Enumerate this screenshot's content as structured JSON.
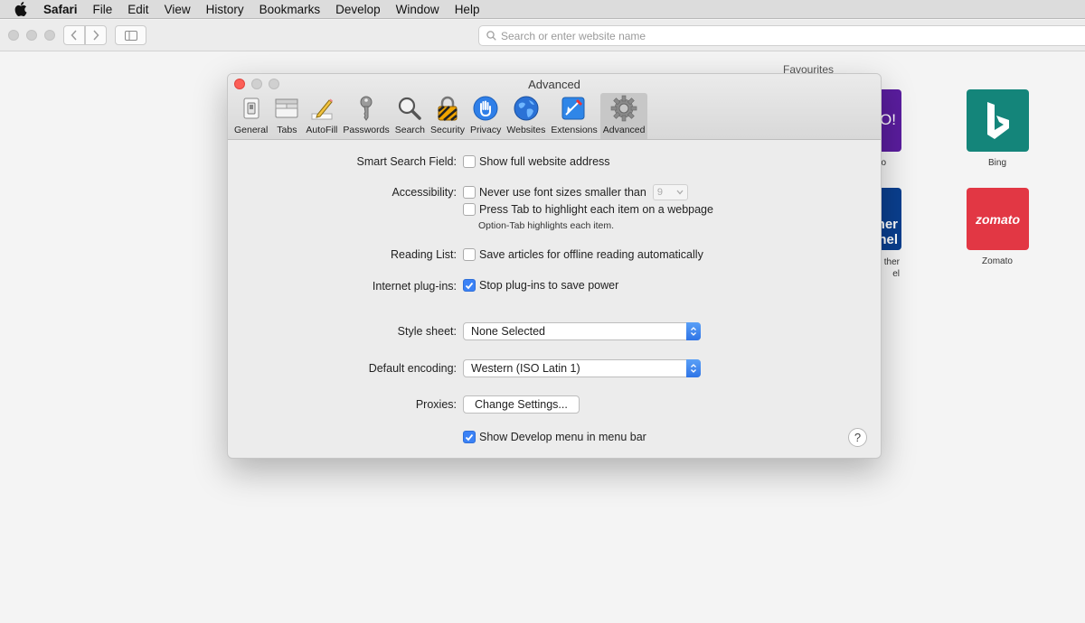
{
  "menubar": {
    "items": [
      "Safari",
      "File",
      "Edit",
      "View",
      "History",
      "Bookmarks",
      "Develop",
      "Window",
      "Help"
    ]
  },
  "toolbar": {
    "search_placeholder": "Search or enter website name"
  },
  "favourites": {
    "title": "Favourites",
    "tiles": [
      {
        "label": "Bing",
        "icon": "bing-logo",
        "color": "#14857a"
      },
      {
        "label": "Zomato",
        "icon": "zomato-logo",
        "text": "zomato",
        "color": "#e23744"
      }
    ],
    "partial_tiles": [
      {
        "text": "O!",
        "color": "#5a1d9e"
      },
      {
        "text": "her\nnel",
        "color": "#0a3f8f"
      }
    ],
    "partial_labels": [
      "o",
      "ther",
      "el"
    ]
  },
  "window": {
    "title": "Advanced",
    "tabs": [
      {
        "label": "General",
        "icon": "general-switch-icon"
      },
      {
        "label": "Tabs",
        "icon": "tabs-icon"
      },
      {
        "label": "AutoFill",
        "icon": "pencil-icon"
      },
      {
        "label": "Passwords",
        "icon": "key-icon"
      },
      {
        "label": "Search",
        "icon": "magnifier-icon"
      },
      {
        "label": "Security",
        "icon": "lock-icon"
      },
      {
        "label": "Privacy",
        "icon": "hand-icon"
      },
      {
        "label": "Websites",
        "icon": "globe-icon"
      },
      {
        "label": "Extensions",
        "icon": "puzzle-icon"
      },
      {
        "label": "Advanced",
        "icon": "gear-icon"
      }
    ],
    "active_tab": "Advanced"
  },
  "settings": {
    "smart_search": {
      "label": "Smart Search Field:",
      "option": "Show full website address",
      "checked": false
    },
    "accessibility": {
      "label": "Accessibility:",
      "font_option": "Never use font sizes smaller than",
      "font_size": "9",
      "font_checked": false,
      "tab_option": "Press Tab to highlight each item on a webpage",
      "tab_checked": false,
      "hint": "Option-Tab highlights each item."
    },
    "reading_list": {
      "label": "Reading List:",
      "option": "Save articles for offline reading automatically",
      "checked": false
    },
    "plugins": {
      "label": "Internet plug-ins:",
      "option": "Stop plug-ins to save power",
      "checked": true
    },
    "style_sheet": {
      "label": "Style sheet:",
      "value": "None Selected"
    },
    "encoding": {
      "label": "Default encoding:",
      "value": "Western (ISO Latin 1)"
    },
    "proxies": {
      "label": "Proxies:",
      "button": "Change Settings..."
    },
    "develop": {
      "option": "Show Develop menu in menu bar",
      "checked": true
    },
    "help": "?"
  },
  "colors": {
    "accent": "#3b82f6",
    "close": "#fc5f57",
    "inactive_light": "#cdcdcd"
  }
}
